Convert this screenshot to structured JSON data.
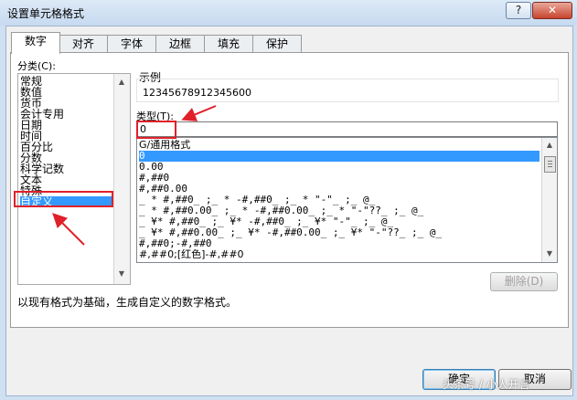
{
  "window": {
    "title": "设置单元格格式",
    "help_label": "?",
    "close_label": "✕"
  },
  "tabs": [
    "数字",
    "对齐",
    "字体",
    "边框",
    "填充",
    "保护"
  ],
  "category": {
    "label": "分类(C):",
    "items": [
      "常规",
      "数值",
      "货币",
      "会计专用",
      "日期",
      "时间",
      "百分比",
      "分数",
      "科学记数",
      "文本",
      "特殊",
      "自定义"
    ],
    "selected": "自定义"
  },
  "sample": {
    "label": "示例",
    "value": "12345678912345600"
  },
  "type_field": {
    "label": "类型(T):",
    "value": "0"
  },
  "format_list": {
    "items": [
      "G/通用格式",
      "0",
      "0.00",
      "#,##0",
      "#,##0.00",
      "_ * #,##0_ ;_ * -#,##0_ ;_ * \"-\"_ ;_ @_ ",
      "_ * #,##0.00_ ;_ * -#,##0.00_ ;_ * \"-\"??_ ;_ @_ ",
      "_ ¥* #,##0_ ;_ ¥* -#,##0_ ;_ ¥* \"-\"_ ;_ @_ ",
      "_ ¥* #,##0.00_ ;_ ¥* -#,##0.00_ ;_ ¥* \"-\"??_ ;_ @_ ",
      "#,##0;-#,##0",
      "#,##0;[红色]-#,##0"
    ],
    "selected": "0"
  },
  "delete_button": "删除(D)",
  "description": "以现有格式为基础，生成自定义的数字格式。",
  "ok_button": "确定",
  "cancel_button": "取消",
  "watermark": "头条号 / 小人开言",
  "colors": {
    "highlight": "#3399ff",
    "annotation": "#e0202a"
  }
}
